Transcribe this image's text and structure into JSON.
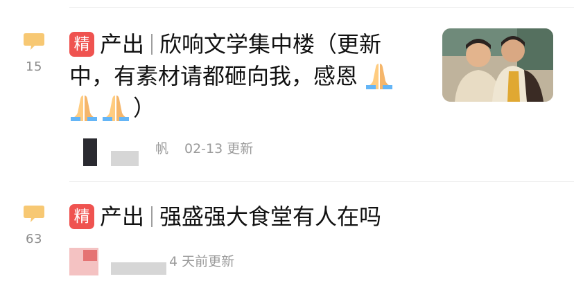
{
  "threads": [
    {
      "badge": "精",
      "category": "产出",
      "title_line1": "欣响文学集中楼（更新",
      "title_line2": "中，有素材请都砸向我，感恩",
      "title_line3": "）",
      "reply_count": "15",
      "author_suffix": "帆",
      "updated": "02-13 更新",
      "emoji": "folded-hands"
    },
    {
      "badge": "精",
      "category": "产出",
      "title_line1": "强盛强大食堂有人在吗",
      "reply_count": "63",
      "updated": "4 天前更新"
    }
  ],
  "colors": {
    "badge": "#ef5350",
    "bubble": "#f7c873",
    "text": "#111111",
    "meta": "#9a9a9a"
  }
}
